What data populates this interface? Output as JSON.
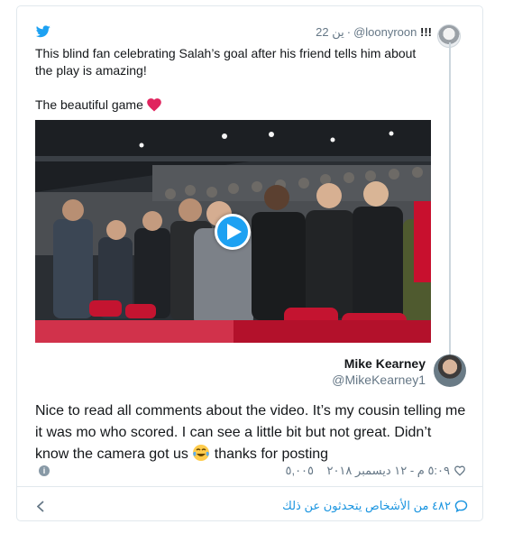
{
  "quoted_tweet": {
    "handle": "@loonyroon",
    "name_marks": "!!!",
    "date": "22 ين",
    "text_line1": "This blind fan celebrating Salah’s goal  after his friend tells him about the play is amazing!",
    "text_line2": "The beautiful game",
    "heart_color": "#e0245e"
  },
  "reply_tweet": {
    "name": "Mike Kearney",
    "handle": "@MikeKearney1",
    "text_before_emoji": "Nice to read all comments about the video. It’s my cousin telling me it was mo who scored. I can see a little bit but not great. Didn’t know the camera got us ",
    "text_after_emoji": " thanks for posting",
    "emoji": "face-with-tears-of-joy",
    "likes": "٥,٠٠٥",
    "timestamp": "٥:٠٩ م - ١٢ ديسمبر ٢٠١٨"
  },
  "footer": {
    "people_talking": "٤٨٢ من الأشخاص يتحدثون عن ذلك"
  },
  "colors": {
    "twitter_blue": "#1da1f2",
    "link_blue": "#1b95e0",
    "secondary_text": "#657786",
    "border": "#e1e8ed"
  }
}
